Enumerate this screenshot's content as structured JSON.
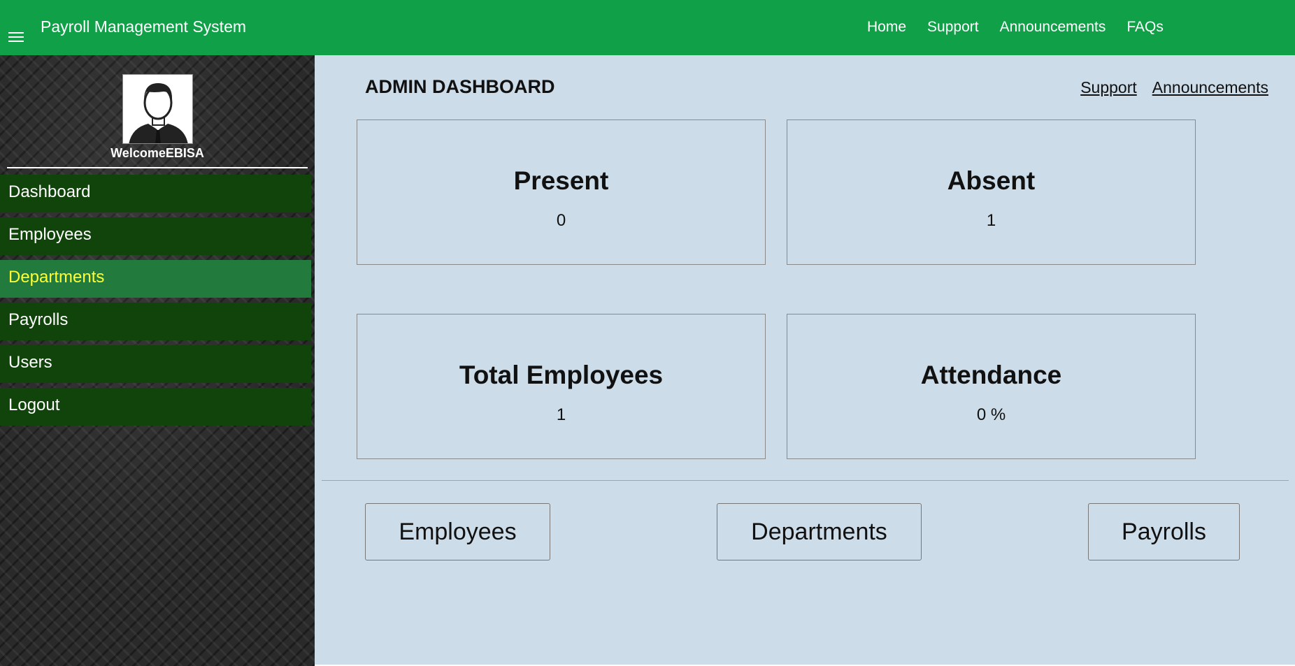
{
  "header": {
    "brand": "Payroll Management System",
    "nav": [
      "Home",
      "Support",
      "Announcements",
      "FAQs"
    ]
  },
  "sidebar": {
    "welcome": "WelcomeEBISA",
    "items": [
      {
        "label": "Dashboard",
        "active": false
      },
      {
        "label": "Employees",
        "active": false
      },
      {
        "label": "Departments",
        "active": true
      },
      {
        "label": "Payrolls",
        "active": false
      },
      {
        "label": "Users",
        "active": false
      },
      {
        "label": "Logout",
        "active": false
      }
    ]
  },
  "main": {
    "title": "ADMIN DASHBOARD",
    "links": [
      "Support",
      "Announcements"
    ],
    "cards": [
      {
        "title": "Present",
        "value": "0"
      },
      {
        "title": "Absent",
        "value": "1"
      },
      {
        "title": "Total Employees",
        "value": "1"
      },
      {
        "title": "Attendance",
        "value": "0 %"
      }
    ],
    "buttons": [
      "Employees",
      "Departments",
      "Payrolls"
    ]
  },
  "colors": {
    "topbar": "#0fa048",
    "menu_item": "#11440b",
    "menu_active": "#227a3c",
    "menu_active_text": "#ffff33",
    "main_bg": "#ccdce8"
  },
  "icons": {
    "menu": "hamburger-menu-icon",
    "avatar": "user-avatar-icon"
  }
}
